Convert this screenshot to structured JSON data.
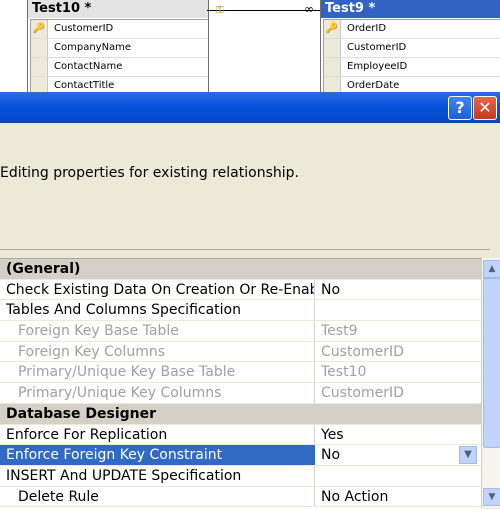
{
  "diagram": {
    "table_left": {
      "title": "Test10 *",
      "columns": [
        "CustomerID",
        "CompanyName",
        "ContactName",
        "ContactTitle"
      ]
    },
    "table_right": {
      "title": "Test9 *",
      "columns": [
        "OrderID",
        "CustomerID",
        "EmployeeID",
        "OrderDate"
      ]
    },
    "relation_many_symbol": "∞"
  },
  "dialog": {
    "help_button": "?",
    "close_button": "✕",
    "description": "Editing properties for existing relationship."
  },
  "properties": {
    "general_category": "(General)",
    "check_existing": {
      "name": "Check Existing Data On Creation Or Re-Enabling",
      "value": "No"
    },
    "tables_columns": "Tables And Columns Specification",
    "fk_base_table": {
      "name": "Foreign Key Base Table",
      "value": "Test9"
    },
    "fk_columns": {
      "name": "Foreign Key Columns",
      "value": "CustomerID"
    },
    "pk_base_table": {
      "name": "Primary/Unique Key Base Table",
      "value": "Test10"
    },
    "pk_columns": {
      "name": "Primary/Unique Key Columns",
      "value": "CustomerID"
    },
    "designer_category": "Database Designer",
    "enforce_replication": {
      "name": "Enforce For Replication",
      "value": "Yes"
    },
    "enforce_fk": {
      "name": "Enforce Foreign Key Constraint",
      "value": "No"
    },
    "insert_update": "INSERT And UPDATE Specification",
    "delete_rule": {
      "name": "Delete Rule",
      "value": "No Action"
    }
  },
  "colors": {
    "titlebar": "#0a55dd",
    "selection": "#316ac5",
    "close": "#c4381d"
  }
}
